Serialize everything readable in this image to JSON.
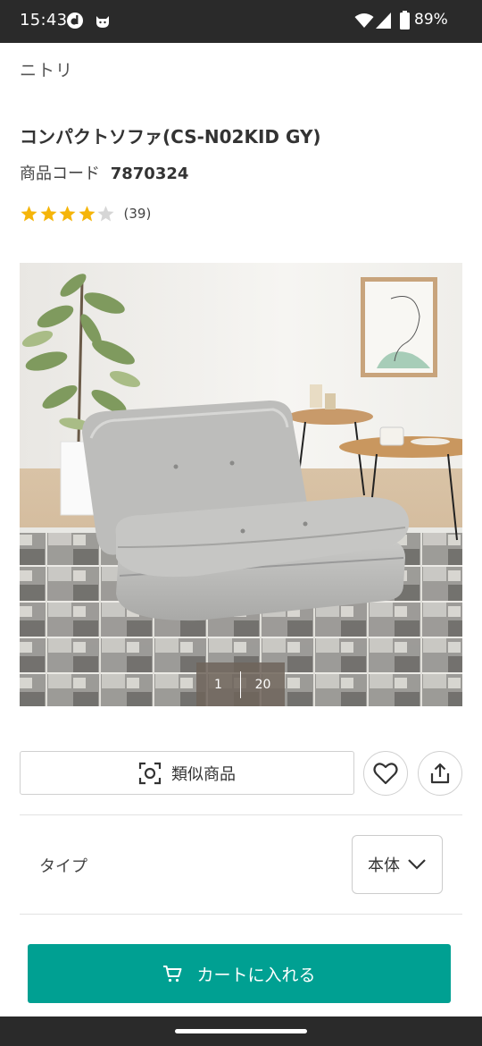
{
  "status_bar": {
    "time": "15:43",
    "battery_percent": "89%",
    "icons": [
      "d-notification-icon",
      "cat-notification-icon",
      "wifi-icon",
      "cellular-signal-icon",
      "battery-icon"
    ]
  },
  "brand": "ニトリ",
  "product": {
    "title": "コンパクトソファ(CS-N02KID GY)",
    "code_label": "商品コード",
    "code_value": "7870324",
    "rating": {
      "value": 4,
      "max": 5,
      "review_count": "(39)"
    }
  },
  "gallery": {
    "current_index": "1",
    "total": "20"
  },
  "actions": {
    "similar_label": "類似商品",
    "favorite_icon": "heart-icon",
    "share_icon": "share-icon"
  },
  "type_selector": {
    "label": "タイプ",
    "value": "本体"
  },
  "cart": {
    "label": "カートに入れる"
  },
  "colors": {
    "accent": "#00a092",
    "star_filled": "#f5b50a",
    "star_empty": "#d6d6d6",
    "system_bar": "#2a2a2a"
  }
}
